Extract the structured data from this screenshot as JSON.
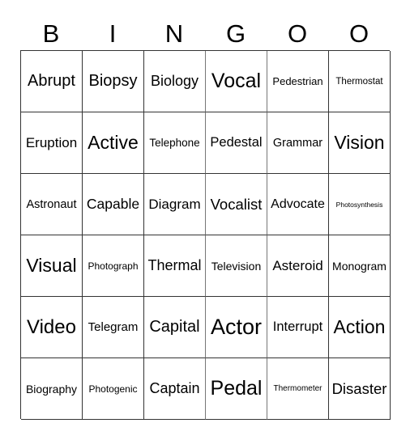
{
  "card": {
    "header_letters": [
      "B",
      "I",
      "N",
      "G",
      "O",
      "O"
    ],
    "rows": [
      [
        "Abrupt",
        "Biopsy",
        "Biology",
        "Vocal",
        "Pedestrian",
        "Thermostat"
      ],
      [
        "Eruption",
        "Active",
        "Telephone",
        "Pedestal",
        "Grammar",
        "Vision"
      ],
      [
        "Astronaut",
        "Capable",
        "Diagram",
        "Vocalist",
        "Advocate",
        "Photosynthesis"
      ],
      [
        "Visual",
        "Photograph",
        "Thermal",
        "Television",
        "Asteroid",
        "Monogram"
      ],
      [
        "Video",
        "Telegram",
        "Capital",
        "Actor",
        "Interrupt",
        "Action"
      ],
      [
        "Biography",
        "Photogenic",
        "Captain",
        "Pedal",
        "Thermometer",
        "Disaster"
      ]
    ]
  }
}
